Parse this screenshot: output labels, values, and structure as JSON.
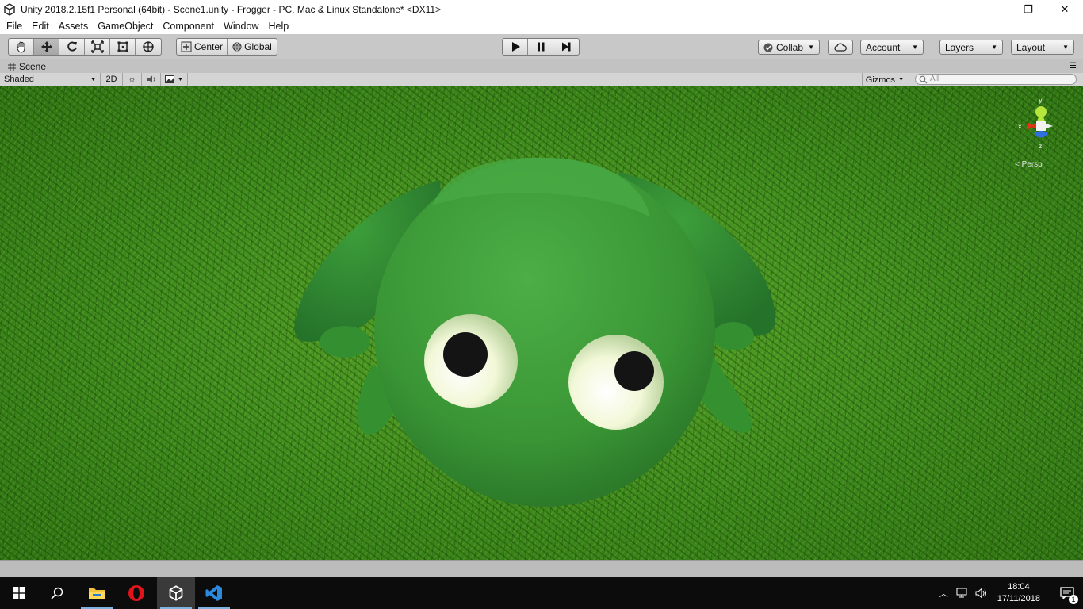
{
  "window": {
    "title": "Unity 2018.2.15f1 Personal (64bit) - Scene1.unity - Frogger - PC, Mac & Linux Standalone* <DX11>",
    "minimize": "—",
    "maximize": "❐",
    "close": "✕"
  },
  "menu": [
    "File",
    "Edit",
    "Assets",
    "GameObject",
    "Component",
    "Window",
    "Help"
  ],
  "toolbar": {
    "pivot_label": "Center",
    "space_label": "Global",
    "collab_label": "Collab",
    "account_label": "Account",
    "layers_label": "Layers",
    "layout_label": "Layout"
  },
  "scene": {
    "tab_label": "Scene",
    "shading_mode": "Shaded",
    "mode_2d": "2D",
    "gizmos_label": "Gizmos",
    "search_placeholder": "All",
    "projection_label": "< Persp",
    "axis_labels": {
      "x": "x",
      "y": "y",
      "z": "z"
    }
  },
  "taskbar": {
    "time": "18:04",
    "date": "17/11/2018",
    "notification_count": "1"
  },
  "colors": {
    "frog_green": "#3e9a3e",
    "grass": "#4b9a23",
    "taskbar": "#0c0c0c"
  }
}
